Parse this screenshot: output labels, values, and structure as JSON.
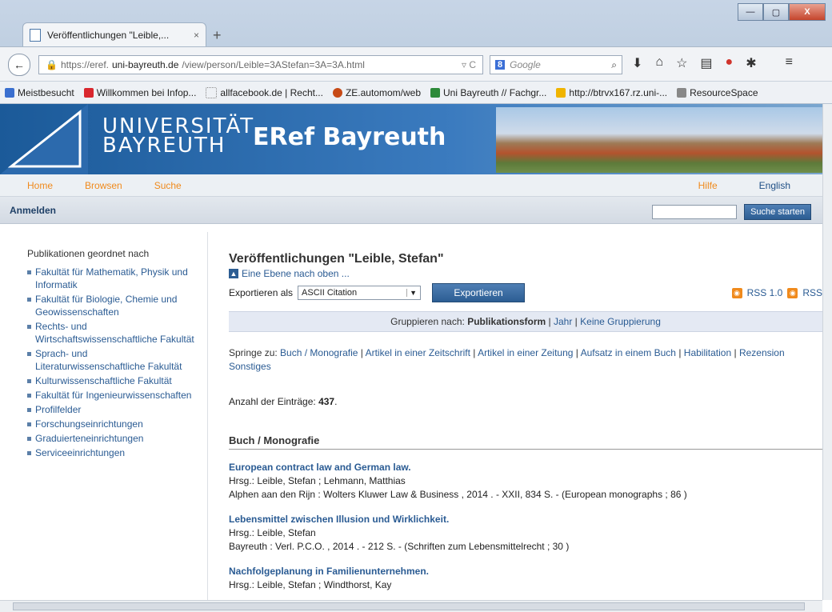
{
  "browser": {
    "tab_title": "Veröffentlichungen \"Leible,...",
    "tab_close": "×",
    "new_tab": "+",
    "url_prefix": "https://eref.",
    "url_host": "uni-bayreuth.de",
    "url_path": "/view/person/Leible=3AStefan=3A=3A.html",
    "search_engine": "8",
    "search_placeholder": "Google",
    "window_min": "—",
    "window_max": "▢",
    "window_close": "X"
  },
  "bookmarks": [
    {
      "label": "Meistbesucht",
      "color": "#3a6fcf"
    },
    {
      "label": "Willkommen bei Infop...",
      "color": "#d9272e"
    },
    {
      "label": "allfacebook.de | Recht...",
      "color": "#cccccc"
    },
    {
      "label": "ZE.automom/web",
      "color": "#c74a16"
    },
    {
      "label": "Uni Bayreuth // Fachgr...",
      "color": "#2d8a3a"
    },
    {
      "label": "http://btrvx167.rz.uni-...",
      "color": "#f0b400"
    },
    {
      "label": "ResourceSpace",
      "color": "#888888"
    }
  ],
  "site": {
    "logo_line1": "UNIVERSITÄT",
    "logo_line2": "BAYREUTH",
    "site_title": "ERef Bayreuth",
    "nav": [
      "Home",
      "Browsen",
      "Suche"
    ],
    "help": "Hilfe",
    "language": "English",
    "login": "Anmelden",
    "search_button": "Suche starten"
  },
  "sidebar": {
    "title": "Publikationen geordnet nach",
    "items": [
      "Fakultät für Mathematik, Physik und Informatik",
      "Fakultät für Biologie, Chemie und Geowissenschaften",
      "Rechts- und Wirtschaftswissenschaftliche Fakultät",
      "Sprach- und Literaturwissenschaftliche Fakultät",
      "Kulturwissenschaftliche Fakultät",
      "Fakultät für Ingenieurwissenschaften",
      "Profilfelder",
      "Forschungseinrichtungen",
      "Graduierteneinrichtungen",
      "Serviceeinrichtungen"
    ]
  },
  "main": {
    "heading": "Veröffentlichungen \"Leible, Stefan\"",
    "up_link": "Eine Ebene nach oben ...",
    "export_label": "Exportieren als",
    "export_format": "ASCII Citation",
    "export_button": "Exportieren",
    "rss1": "RSS 1.0",
    "rss2": "RSS",
    "group_label": "Gruppieren nach:",
    "group_current": "Publikationsform",
    "group_opt1": "Jahr",
    "group_opt2": "Keine Gruppierung",
    "jump_label": "Springe zu:",
    "jump_links": [
      "Buch / Monografie",
      "Artikel in einer Zeitschrift",
      "Artikel in einer Zeitung",
      "Aufsatz in einem Buch",
      "Habilitation",
      "Rezension",
      "Sonstiges"
    ],
    "count_label": "Anzahl der Einträge:",
    "count_value": "437",
    "section": "Buch / Monografie",
    "entries": [
      {
        "title": "European contract law and German law.",
        "authors": "Hrsg.: Leible, Stefan ; Lehmann, Matthias",
        "details": "Alphen aan den Rijn : Wolters Kluwer Law & Business , 2014 . - XXII, 834 S. - (European monographs ; 86 )"
      },
      {
        "title": "Lebensmittel zwischen Illusion und Wirklichkeit.",
        "authors": "Hrsg.: Leible, Stefan",
        "details": "Bayreuth : Verl. P.C.O. , 2014 . - 212 S. - (Schriften zum Lebensmittelrecht ; 30 )"
      },
      {
        "title": "Nachfolgeplanung in Familienunternehmen.",
        "authors": "Hrsg.: Leible, Stefan ; Windthorst, Kay",
        "details": ""
      }
    ]
  }
}
